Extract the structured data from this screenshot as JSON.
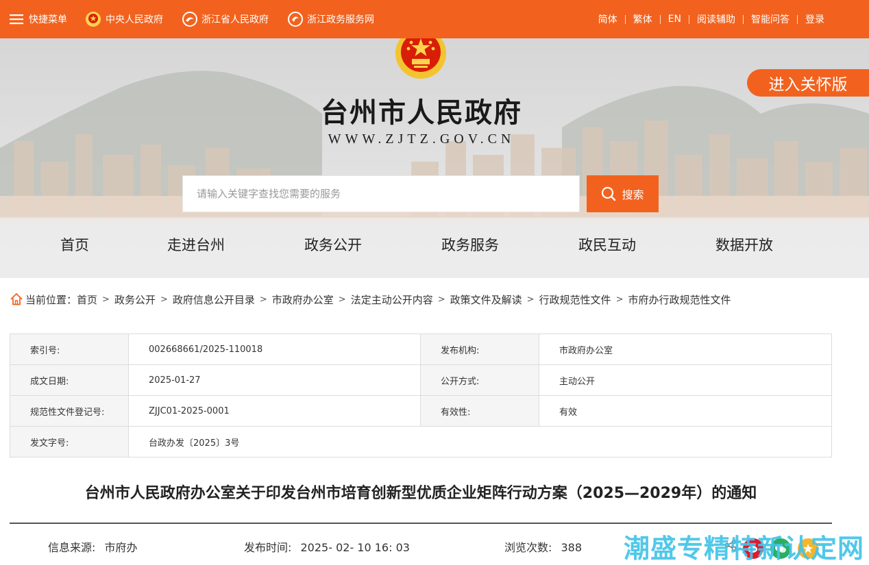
{
  "topbar": {
    "menu_label": "快捷菜单",
    "links": [
      {
        "label": "中央人民政府"
      },
      {
        "label": "浙江省人民政府"
      },
      {
        "label": "浙江政务服务网"
      }
    ],
    "right_links": [
      "简体",
      "繁体",
      "EN",
      "阅读辅助",
      "智能问答",
      "登录"
    ]
  },
  "header": {
    "title": "台州市人民政府",
    "url": "WWW.ZJTZ.GOV.CN",
    "care_button": "进入关怀版"
  },
  "search": {
    "placeholder": "请输入关键字查找您需要的服务",
    "value": "",
    "button_label": "搜索"
  },
  "nav": {
    "items": [
      "首页",
      "走进台州",
      "政务公开",
      "政务服务",
      "政民互动",
      "数据开放"
    ]
  },
  "breadcrumb": {
    "label": "当前位置：",
    "items": [
      "首页",
      "政务公开",
      "政府信息公开目录",
      "市政府办公室",
      "法定主动公开内容",
      "政策文件及解读",
      "行政规范性文件",
      "市府办行政规范性文件"
    ]
  },
  "meta": {
    "index_no_label": "索引号:",
    "index_no": "002668661/2025-110018",
    "publisher_label": "发布机构:",
    "publisher": "市政府办公室",
    "date_label": "成文日期:",
    "date": "2025-01-27",
    "method_label": "公开方式:",
    "method": "主动公开",
    "reg_no_label": "规范性文件登记号:",
    "reg_no": "ZJJC01-2025-0001",
    "validity_label": "有效性:",
    "validity": "有效",
    "doc_no_label": "发文字号:",
    "doc_no": "台政办发〔2025〕3号"
  },
  "article": {
    "title": "台州市人民政府办公室关于印发台州市培育创新型优质企业矩阵行动方案（2025—2029年）的通知",
    "source_label": "信息来源:",
    "source": "市府办",
    "time_label": "发布时间:",
    "time": "2025- 02- 10 16: 03",
    "views_label": "浏览次数:",
    "views": "388"
  },
  "watermark": "潮盛专精特新认定网",
  "colors": {
    "accent": "#f2621e",
    "watermark": "#43c4e8"
  }
}
